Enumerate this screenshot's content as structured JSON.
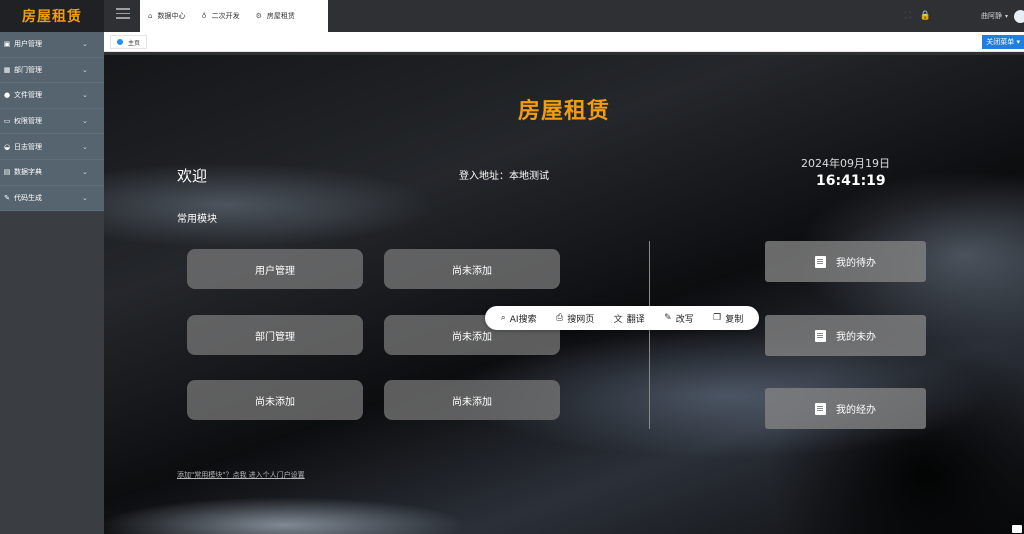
{
  "app": {
    "logo": "房屋租赁"
  },
  "sidebar": {
    "items": [
      {
        "icon": "user-icon",
        "glyph": "▣",
        "label": "用户管理"
      },
      {
        "icon": "department-icon",
        "glyph": "▦",
        "label": "部门管理"
      },
      {
        "icon": "file-icon",
        "glyph": "●",
        "label": "文件管理"
      },
      {
        "icon": "permission-icon",
        "glyph": "▭",
        "label": "权限管理"
      },
      {
        "icon": "log-icon",
        "glyph": "◒",
        "label": "日志管理"
      },
      {
        "icon": "dictionary-icon",
        "glyph": "▤",
        "label": "数据字典"
      },
      {
        "icon": "code-icon",
        "glyph": "✎",
        "label": "代码生成"
      }
    ],
    "chevron": "⌄"
  },
  "topbar": {
    "tabs": [
      {
        "icon": "home-icon",
        "glyph": "⌂",
        "label": "数据中心"
      },
      {
        "icon": "bulb-icon",
        "glyph": "♁",
        "label": "二次开发"
      },
      {
        "icon": "gear-icon",
        "glyph": "⚙",
        "label": "房屋租赁"
      }
    ],
    "fullscreen_glyph": "⛶",
    "lock_glyph": "🔒",
    "username": "曲阿静",
    "caret": "▾"
  },
  "subbar": {
    "home_tab": "主页",
    "close_menu": "关闭菜单 ▾"
  },
  "main": {
    "title": "房屋租赁",
    "welcome": "欢迎",
    "login": "登入地址：本地测试",
    "date": "2024年09月19日",
    "time": "16:41:19",
    "section": "常用模块",
    "modules": [
      "用户管理",
      "尚未添加",
      "部门管理",
      "尚未添加",
      "尚未添加",
      "尚未添加"
    ],
    "todos": [
      "我的待办",
      "我的未办",
      "我的经办"
    ],
    "hint": "添加\"常用模块\"？点我 进入个人门户设置"
  },
  "floatbar": {
    "items": [
      {
        "icon": "search-icon",
        "glyph": "⌕",
        "label": "AI搜索"
      },
      {
        "icon": "webpage-search-icon",
        "glyph": "⎙",
        "label": "搜网页"
      },
      {
        "icon": "translate-icon",
        "glyph": "文",
        "label": "翻译"
      },
      {
        "icon": "rewrite-icon",
        "glyph": "✎",
        "label": "改写"
      },
      {
        "icon": "copy-icon",
        "glyph": "❐",
        "label": "复制"
      }
    ]
  }
}
